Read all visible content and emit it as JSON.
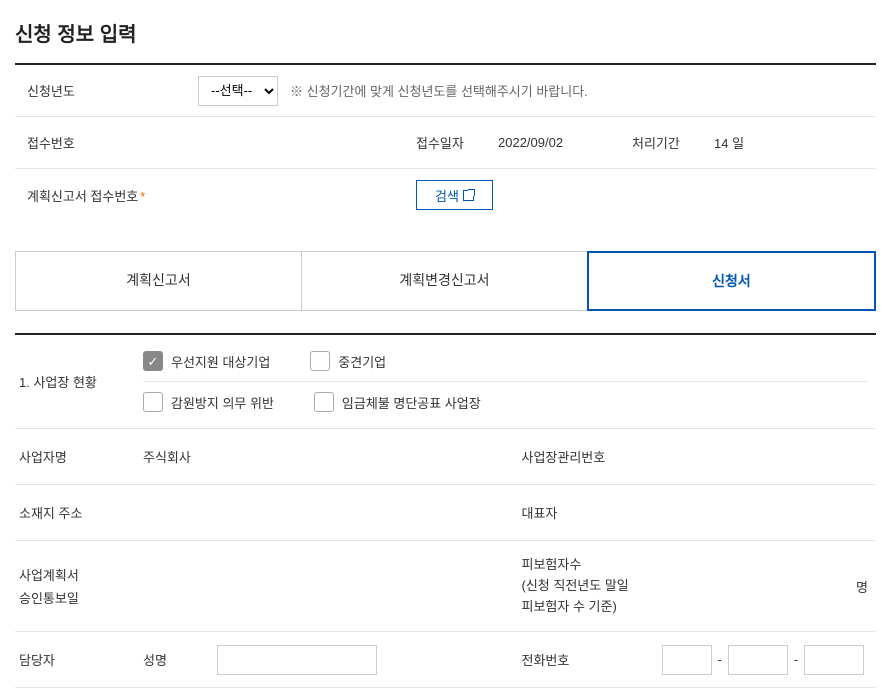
{
  "page": {
    "title": "신청 정보 입력"
  },
  "form": {
    "year_label": "신청년도",
    "year_select_placeholder": "--선택--",
    "year_hint": "※ 신청기간에 맞게 신청년도를 선택해주시기 바랍니다.",
    "receipt_no_label": "접수번호",
    "receipt_date_label": "접수일자",
    "receipt_date_value": "2022/09/02",
    "process_period_label": "처리기간",
    "process_period_value": "14 일",
    "plan_receipt_no_label": "계획신고서 접수번호",
    "search_button": "검색"
  },
  "tabs": [
    {
      "label": "계획신고서"
    },
    {
      "label": "계획변경신고서"
    },
    {
      "label": "신청서"
    }
  ],
  "active_tab": 2,
  "detail": {
    "section1_label": "1. 사업장 현황",
    "checkboxes": {
      "row1": [
        {
          "label": "우선지원 대상기업",
          "checked": true
        },
        {
          "label": "중견기업",
          "checked": false
        }
      ],
      "row2": [
        {
          "label": "감원방지 의무 위반",
          "checked": false
        },
        {
          "label": "임금체불 명단공표 사업장",
          "checked": false
        }
      ]
    },
    "biz_name_label": "사업자명",
    "biz_name_value": "주식회사",
    "biz_mgmt_no_label": "사업장관리번호",
    "address_label": "소재지 주소",
    "ceo_label": "대표자",
    "plan_approval_label_1": "사업계획서",
    "plan_approval_label_2": "승인통보일",
    "insured_label_1": "피보험자수",
    "insured_label_2": "(신청 직전년도 말일",
    "insured_label_3": "피보험자 수 기준)",
    "insured_unit": "명",
    "contact_label": "담당자",
    "contact_name_label": "성명",
    "contact_phone_label": "전화번호",
    "phone_sep": "-"
  }
}
